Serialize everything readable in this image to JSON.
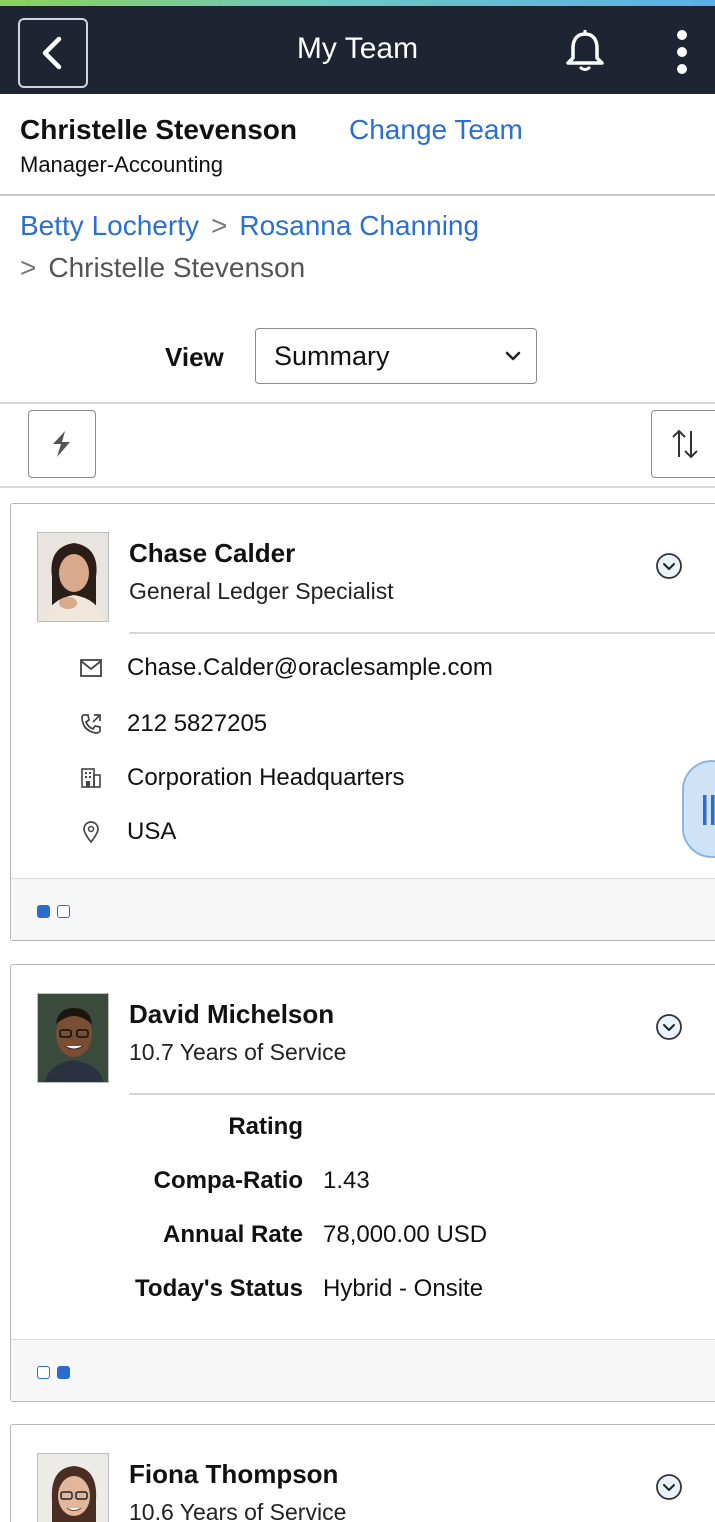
{
  "header": {
    "title": "My Team"
  },
  "manager": {
    "name": "Christelle Stevenson",
    "change_team_label": "Change Team",
    "title": "Manager-Accounting"
  },
  "breadcrumb": {
    "items": [
      "Betty Locherty",
      "Rosanna Channing",
      "Christelle Stevenson"
    ],
    "separator": ">"
  },
  "view": {
    "label": "View",
    "selected": "Summary"
  },
  "cards": [
    {
      "name": "Chase Calder",
      "subtitle": "General Ledger Specialist",
      "email": "Chase.Calder@oraclesample.com",
      "phone": "212 5827205",
      "location": "Corporation Headquarters",
      "country": "USA",
      "page_indicator": {
        "pages": 2,
        "active": 1
      }
    },
    {
      "name": "David Michelson",
      "subtitle": "10.7 Years of Service",
      "fields": [
        {
          "label": "Rating",
          "value": ""
        },
        {
          "label": "Compa-Ratio",
          "value": "1.43"
        },
        {
          "label": "Annual Rate",
          "value": "78,000.00 USD"
        },
        {
          "label": "Today's Status",
          "value": "Hybrid - Onsite"
        }
      ],
      "page_indicator": {
        "pages": 2,
        "active": 2
      }
    },
    {
      "name": "Fiona Thompson",
      "subtitle": "10.6 Years of Service"
    }
  ],
  "colors": {
    "topbar": "#1f2433",
    "link": "#2b6fd1",
    "dot_active": "#2a6cd0",
    "handle": "#cfe3f7"
  },
  "icons": [
    "back-icon",
    "bell-icon",
    "kebab-icon",
    "chevron-down-icon",
    "hierarchy-icon",
    "sort-icon",
    "mail-icon",
    "phone-icon",
    "building-icon",
    "location-pin-icon",
    "pause-handle-icon"
  ]
}
